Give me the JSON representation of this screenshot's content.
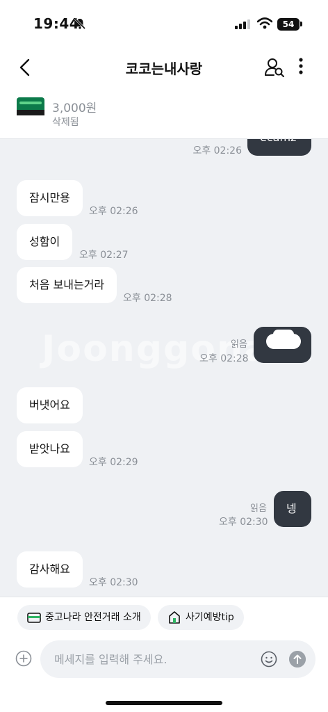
{
  "status_bar": {
    "time": "19:44",
    "battery": "54"
  },
  "header": {
    "title": "코코는내사랑"
  },
  "product": {
    "price": "3,000원",
    "status": "삭제됨"
  },
  "watermark": "Joonggonara",
  "messages": [
    {
      "direction": "out",
      "text": "ecamz",
      "time": "오후 02:26",
      "read": ""
    },
    {
      "direction": "in",
      "text": "잠시만용",
      "time": "오후 02:26"
    },
    {
      "direction": "in",
      "text": "성함이",
      "time": "오후 02:27"
    },
    {
      "direction": "in",
      "text": "처음 보내는거라",
      "time": "오후 02:28"
    },
    {
      "direction": "out",
      "text": "",
      "time": "오후 02:28",
      "read": "읽음"
    },
    {
      "direction": "in",
      "text": "버냇어요",
      "time": ""
    },
    {
      "direction": "in",
      "text": "받앗나요",
      "time": "오후 02:29"
    },
    {
      "direction": "out",
      "text": "넹",
      "time": "오후 02:30",
      "read": "읽음"
    },
    {
      "direction": "in",
      "text": "감사해요",
      "time": "오후 02:30"
    }
  ],
  "chips": [
    {
      "label": "중고나라 안전거래 소개",
      "icon": "wallet-icon"
    },
    {
      "label": "사기예방tip",
      "icon": "house-icon"
    }
  ],
  "input": {
    "placeholder": "메세지를 입력해 주세요."
  },
  "colors": {
    "chat_bg": "#eff1f4",
    "out_bubble": "#323841",
    "meta": "#8a8f96"
  }
}
